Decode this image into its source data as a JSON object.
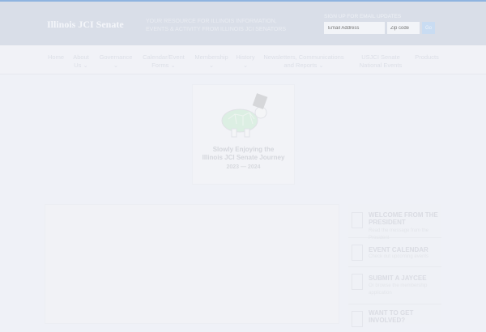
{
  "header": {
    "site_title": "Illinois JCI Senate",
    "tagline": "Your resource for Illinois information, events & activity from Illinois JCI Senators",
    "signup_label": "Sign up for email updates",
    "email_placeholder": "Email Address",
    "zip_placeholder": "Zip code",
    "go_label": "Go"
  },
  "nav": [
    {
      "label": "Home"
    },
    {
      "label": "About Us ⌄"
    },
    {
      "label": "Governance ⌄"
    },
    {
      "label": "Calendar/Event Forms ⌄"
    },
    {
      "label": "Membership ⌄"
    },
    {
      "label": "History ⌄"
    },
    {
      "label": "Newsletters, Communications and Reports ⌄"
    },
    {
      "label": "USJCI Senate National Events"
    },
    {
      "label": "Products"
    }
  ],
  "feature": {
    "line1": "Slowly Enjoying the",
    "line2": "Illinois JCI Senate Journey",
    "years": "2023 — 2024"
  },
  "sidebar": [
    {
      "title": "WELCOME FROM THE PRESIDENT",
      "sub": "Read the message from the President"
    },
    {
      "title": "EVENT CALENDAR",
      "sub": "Check out upcoming events"
    },
    {
      "title": "SUBMIT A JAYCEE",
      "sub": "Or browse the membership application"
    },
    {
      "title": "WANT TO GET INVOLVED?",
      "sub": ""
    }
  ]
}
